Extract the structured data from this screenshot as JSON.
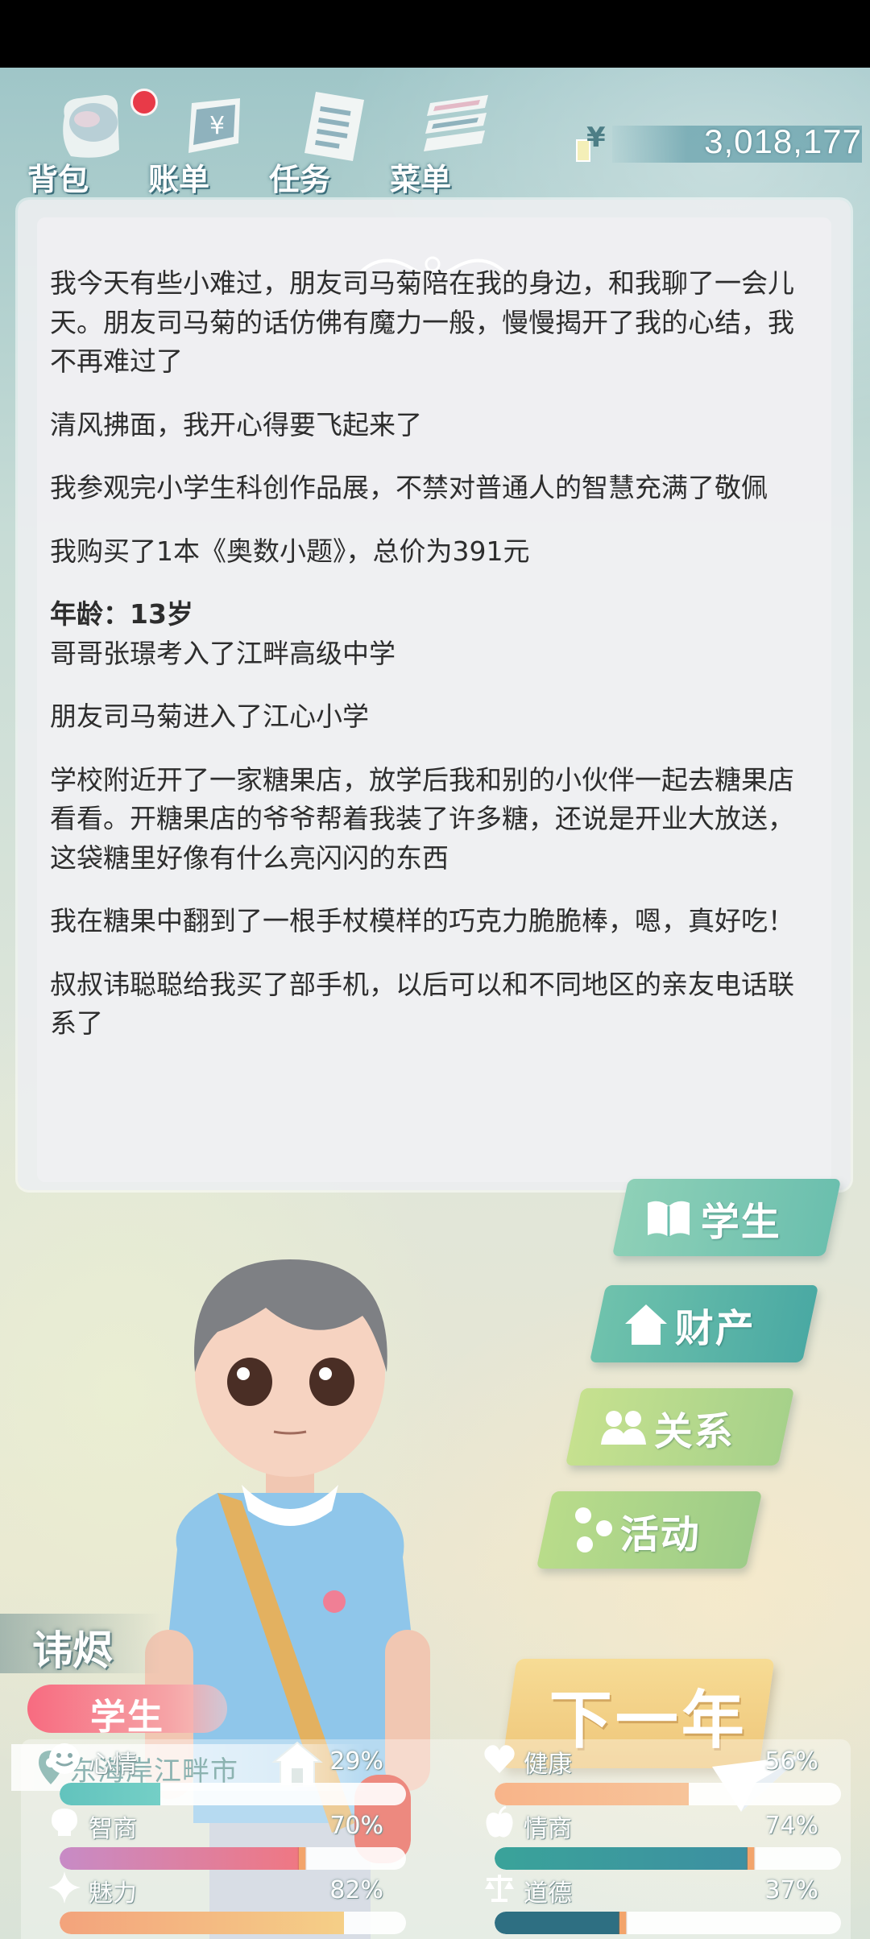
{
  "nav": [
    {
      "label": "背包",
      "icon": "bag-icon",
      "badge": true
    },
    {
      "label": "账单",
      "icon": "bill-icon"
    },
    {
      "label": "任务",
      "icon": "task-list-icon"
    },
    {
      "label": "菜单",
      "icon": "menu-stack-icon"
    }
  ],
  "money": {
    "currency_icon": "yen-icon",
    "value": "3,018,177"
  },
  "story": {
    "paragraphs_before_age": [
      "我今天有些小难过，朋友司马菊陪在我的身边，和我聊了一会儿天。朋友司马菊的话仿佛有魔力一般，慢慢揭开了我的心结，我不再难过了",
      "清风拂面，我开心得要飞起来了",
      "我参观完小学生科创作品展，不禁对普通人的智慧充满了敬佩",
      "我购买了1本《奥数小题》，总价为391元"
    ],
    "age_label": "年龄：13岁",
    "paragraphs_after_age": [
      "哥哥张璟考入了江畔高级中学",
      "朋友司马菊进入了江心小学",
      "学校附近开了一家糖果店，放学后我和别的小伙伴一起去糖果店看看。开糖果店的爷爷帮着我装了许多糖，还说是开业大放送，这袋糖里好像有什么亮闪闪的东西",
      "我在糖果中翻到了一根手杖模样的巧克力脆脆棒，嗯，真好吃！",
      "叔叔讳聪聪给我买了部手机，以后可以和不同地区的亲友电话联系了"
    ]
  },
  "side_buttons": [
    {
      "label": "学生",
      "icon": "book-icon",
      "color": "#7cc8b0"
    },
    {
      "label": "财产",
      "icon": "house-icon",
      "color": "#5db5a9"
    },
    {
      "label": "关系",
      "icon": "people-icon",
      "color": "#b6d985"
    },
    {
      "label": "活动",
      "icon": "activity-icon",
      "color": "#a9d18a"
    }
  ],
  "next_year": {
    "label": "下一年"
  },
  "character": {
    "name": "讳烬",
    "role": "学生",
    "location": "东海岸江畔市"
  },
  "stats": [
    {
      "label": "心情",
      "icon": "smile-icon",
      "value": 29,
      "pct": "29%",
      "colors": [
        "#62c3bd",
        "#74cfc6"
      ]
    },
    {
      "label": "健康",
      "icon": "heart-icon",
      "value": 56,
      "pct": "56%",
      "colors": [
        "#f8b489",
        "#f7c49a"
      ]
    },
    {
      "label": "智商",
      "icon": "bulb-icon",
      "value": 70,
      "pct": "70%",
      "colors": [
        "#c78bc6",
        "#f07782"
      ]
    },
    {
      "label": "情商",
      "icon": "apple-icon",
      "value": 74,
      "pct": "74%",
      "colors": [
        "#3aa39a",
        "#3d8fa1"
      ]
    },
    {
      "label": "魅力",
      "icon": "sparkle-icon",
      "value": 82,
      "pct": "82%",
      "colors": [
        "#f3a37c",
        "#f5cf87"
      ]
    },
    {
      "label": "道德",
      "icon": "scale-icon",
      "value": 37,
      "pct": "37%",
      "colors": [
        "#2e6f82",
        "#2e6f82"
      ]
    }
  ]
}
